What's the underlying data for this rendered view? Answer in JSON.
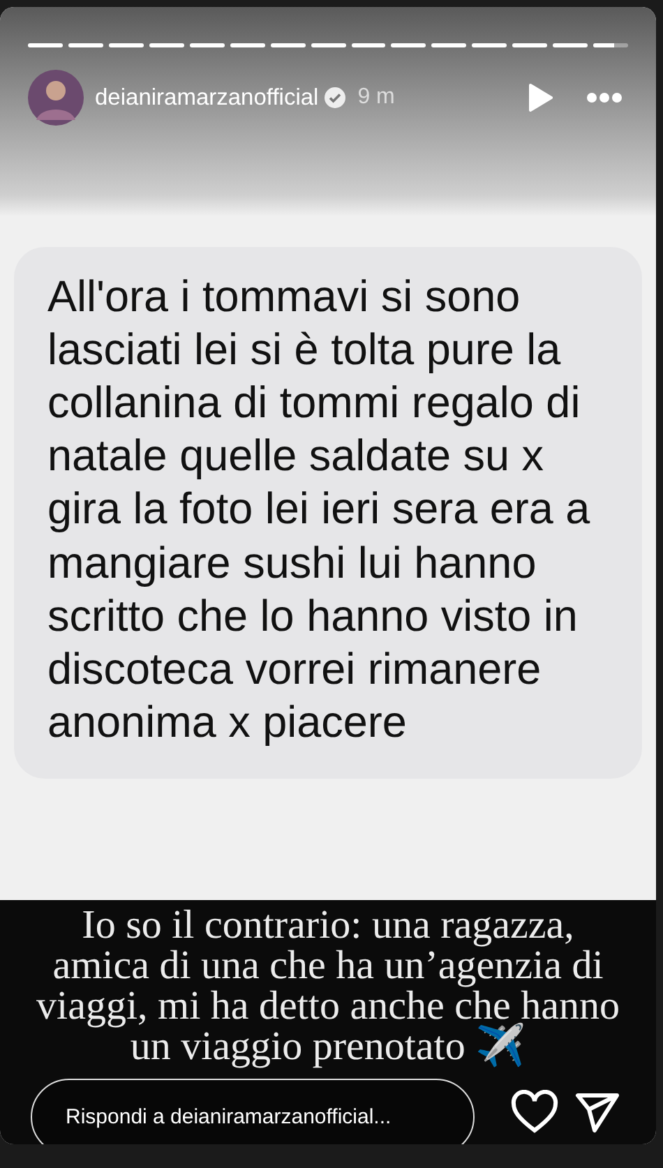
{
  "progress": [
    {
      "level": 1
    },
    {
      "level": 1
    },
    {
      "level": 1
    },
    {
      "level": 1
    },
    {
      "level": 1
    },
    {
      "level": 1
    },
    {
      "level": 1
    },
    {
      "level": 1
    },
    {
      "level": 1
    },
    {
      "level": 1
    },
    {
      "level": 1
    },
    {
      "level": 1
    },
    {
      "level": 1
    },
    {
      "level": 1
    },
    {
      "level": 0.6
    }
  ],
  "header": {
    "username": "deianiramarzanofficial",
    "verified": true,
    "time": "9 m"
  },
  "message": "All'ora i tommavi si sono lasciati lei si è tolta pure la collanina di tommi regalo di natale quelle saldate su x gira la foto lei ieri sera era a mangiare sushi lui hanno scritto che lo hanno visto in discoteca vorrei rimanere anonima x piacere",
  "caption": "Io so il contrario: una ragazza, amica di una che ha un’agenzia di viaggi, mi ha detto anche che hanno un viaggio prenotato ✈️",
  "reply": {
    "placeholder": "Rispondi a deianiramarzanofficial..."
  }
}
